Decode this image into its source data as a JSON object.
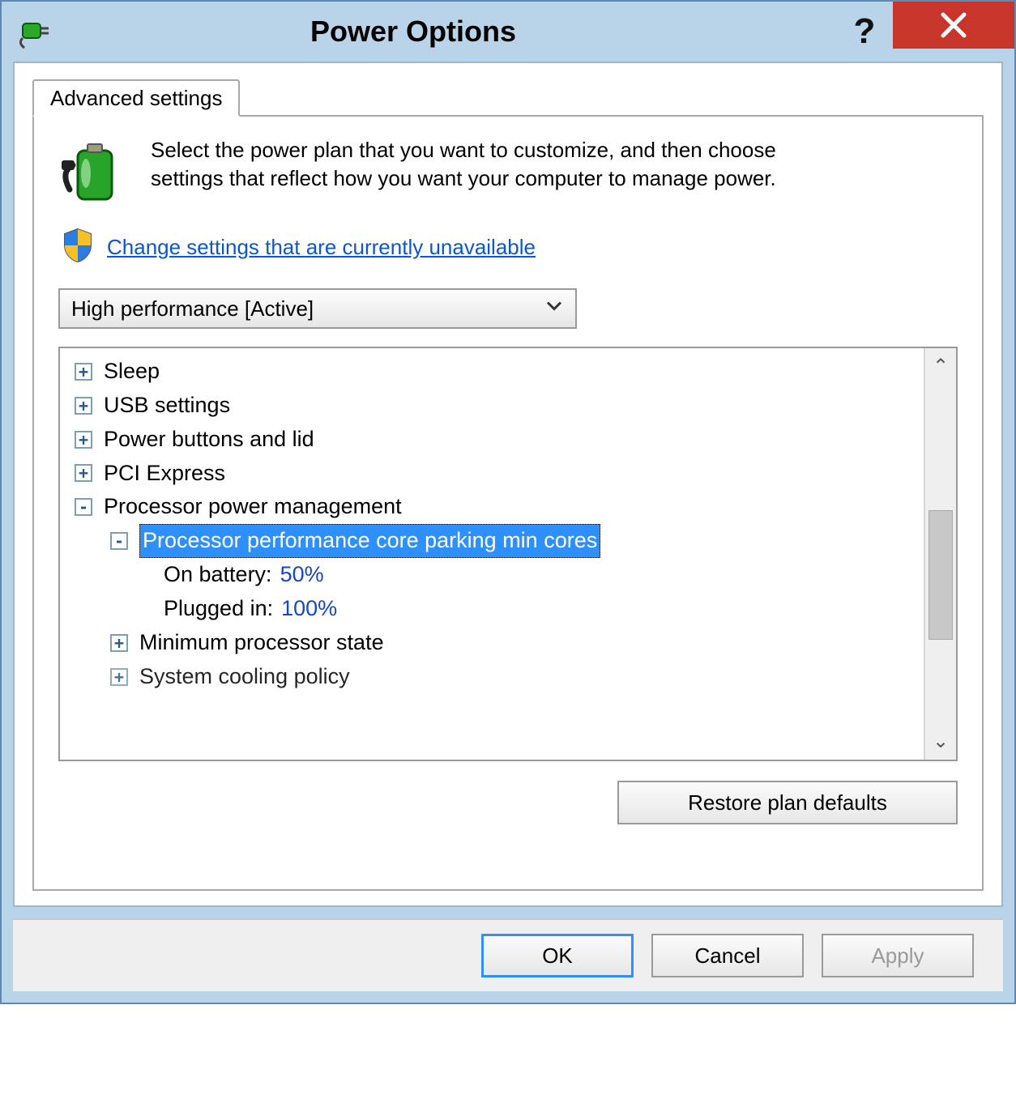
{
  "window": {
    "title": "Power Options"
  },
  "tab": {
    "label": "Advanced settings"
  },
  "intro": "Select the power plan that you want to customize, and then choose settings that reflect how you want your computer to manage power.",
  "uac_link": "Change settings that are currently unavailable",
  "plan": {
    "selected": "High performance [Active]"
  },
  "tree": {
    "items": [
      {
        "label": "Sleep"
      },
      {
        "label": "USB settings"
      },
      {
        "label": "Power buttons and lid"
      },
      {
        "label": "PCI Express"
      },
      {
        "label": "Processor power management"
      },
      {
        "label": "Processor performance core parking min cores"
      },
      {
        "on_battery_label": "On battery:",
        "on_battery_value": "50%"
      },
      {
        "plugged_in_label": "Plugged in:",
        "plugged_in_value": "100%"
      },
      {
        "label": "Minimum processor state"
      },
      {
        "label": "System cooling policy"
      }
    ]
  },
  "buttons": {
    "restore": "Restore plan defaults",
    "ok": "OK",
    "cancel": "Cancel",
    "apply": "Apply"
  }
}
